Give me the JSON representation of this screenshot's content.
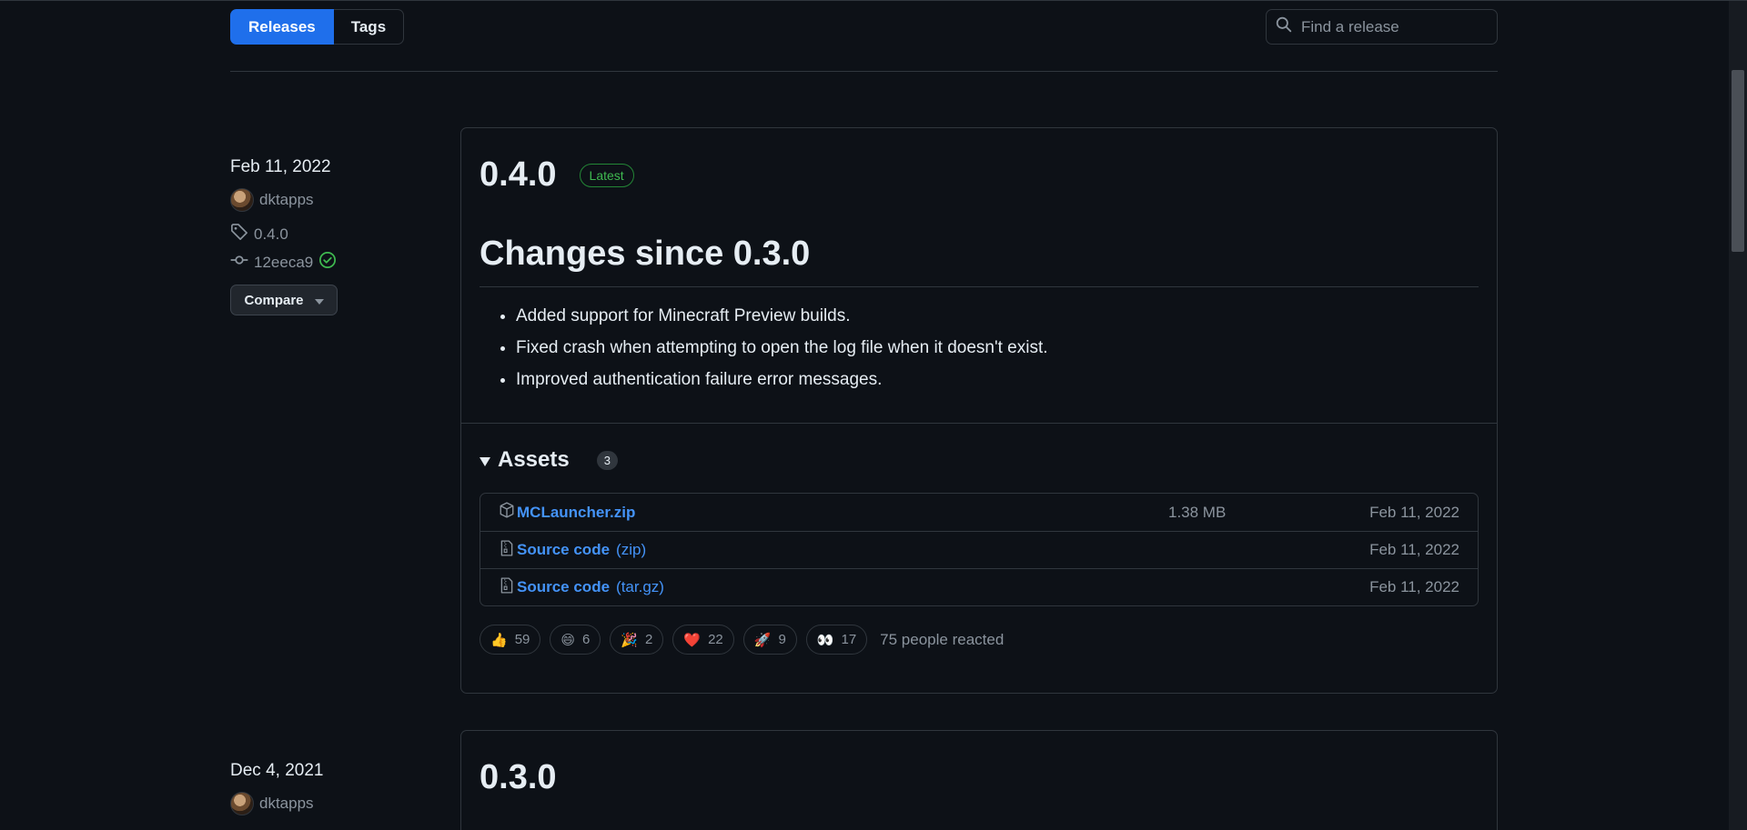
{
  "subnav": {
    "releases": "Releases",
    "tags": "Tags"
  },
  "search": {
    "placeholder": "Find a release"
  },
  "releases": [
    {
      "date": "Feb 11, 2022",
      "author": "dktapps",
      "tag": "0.4.0",
      "commit": "12eeca9",
      "compare_label": "Compare",
      "title": "0.4.0",
      "latest_label": "Latest",
      "heading": "Changes since 0.3.0",
      "notes": [
        "Added support for Minecraft Preview builds.",
        "Fixed crash when attempting to open the log file when it doesn't exist.",
        "Improved authentication failure error messages."
      ],
      "assets_label": "Assets",
      "assets_count": "3",
      "assets": [
        {
          "name": "MCLauncher.zip",
          "suffix": "",
          "size": "1.38 MB",
          "date": "Feb 11, 2022",
          "icon": "package-icon"
        },
        {
          "name": "Source code",
          "suffix": "(zip)",
          "size": "",
          "date": "Feb 11, 2022",
          "icon": "file-zip-icon"
        },
        {
          "name": "Source code",
          "suffix": "(tar.gz)",
          "size": "",
          "date": "Feb 11, 2022",
          "icon": "file-zip-icon"
        }
      ],
      "reactions": [
        {
          "emoji": "👍",
          "count": "59",
          "name": "thumbs-up"
        },
        {
          "emoji": "😄",
          "count": "6",
          "name": "laugh"
        },
        {
          "emoji": "🎉",
          "count": "2",
          "name": "hooray"
        },
        {
          "emoji": "❤️",
          "count": "22",
          "name": "heart"
        },
        {
          "emoji": "🚀",
          "count": "9",
          "name": "rocket"
        },
        {
          "emoji": "👀",
          "count": "17",
          "name": "eyes"
        }
      ],
      "reacted_text": "75 people reacted"
    },
    {
      "date": "Dec 4, 2021",
      "author": "dktapps",
      "title": "0.3.0"
    }
  ],
  "colors": {
    "background": "#0d1117",
    "accent": "#1f6feb",
    "link": "#4493f8",
    "latest_green": "#3fb950",
    "border": "#30363d"
  }
}
